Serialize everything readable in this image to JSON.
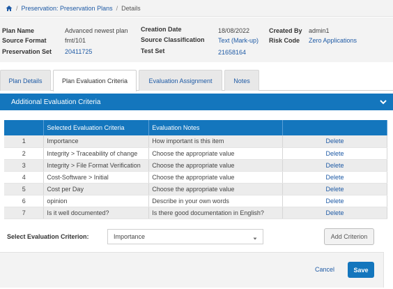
{
  "breadcrumb": {
    "items": [
      "Preservation: Preservation Plans",
      "Details"
    ]
  },
  "info": {
    "plan_name_label": "Plan Name",
    "plan_name_value": "Advanced newest plan",
    "source_format_label": "Source Format",
    "source_format_value": "fmt/101",
    "preservation_set_label": "Preservation Set",
    "preservation_set_value": "20411725",
    "creation_date_label": "Creation Date",
    "creation_date_value": "18/08/2022",
    "source_classification_label": "Source Classification",
    "source_classification_value": "Text (Mark-up)",
    "test_set_label": "Test Set",
    "test_set_value": "21658164",
    "created_by_label": "Created By",
    "created_by_value": "admin1",
    "risk_code_label": "Risk Code",
    "risk_code_value": "Zero Applications"
  },
  "tabs": [
    "Plan Details",
    "Plan Evaluation Criteria",
    "Evaluation Assignment",
    "Notes"
  ],
  "section": {
    "title": "Additional Evaluation Criteria"
  },
  "table": {
    "headers": [
      "",
      "Selected Evaluation Criteria",
      "Evaluation Notes",
      ""
    ],
    "rows": [
      {
        "num": "1",
        "criteria": "Importance",
        "notes": "How important is this item",
        "action": "Delete"
      },
      {
        "num": "2",
        "criteria": "Integrity > Traceability of change",
        "notes": "Choose the appropriate value",
        "action": "Delete"
      },
      {
        "num": "3",
        "criteria": "Integrity > File Format Verification",
        "notes": "Choose the appropriate value",
        "action": "Delete"
      },
      {
        "num": "4",
        "criteria": "Cost-Software > Initial",
        "notes": "Choose the appropriate value",
        "action": "Delete"
      },
      {
        "num": "5",
        "criteria": "Cost per Day",
        "notes": "Choose the appropriate value",
        "action": "Delete"
      },
      {
        "num": "6",
        "criteria": "opinion",
        "notes": "Describe in your own words",
        "action": "Delete"
      },
      {
        "num": "7",
        "criteria": "Is it well documented?",
        "notes": "Is there good documentation in English?",
        "action": "Delete"
      }
    ]
  },
  "criterion": {
    "label": "Select Evaluation Criterion:",
    "selected": "Importance",
    "add_label": "Add Criterion"
  },
  "footer": {
    "cancel_label": "Cancel",
    "save_label": "Save"
  },
  "colors": {
    "accent": "#1476bd",
    "link": "#1e5aa5"
  },
  "icons": {
    "home": "home-icon",
    "chevron": "chevron-down-icon",
    "caret": "caret-down-icon"
  }
}
